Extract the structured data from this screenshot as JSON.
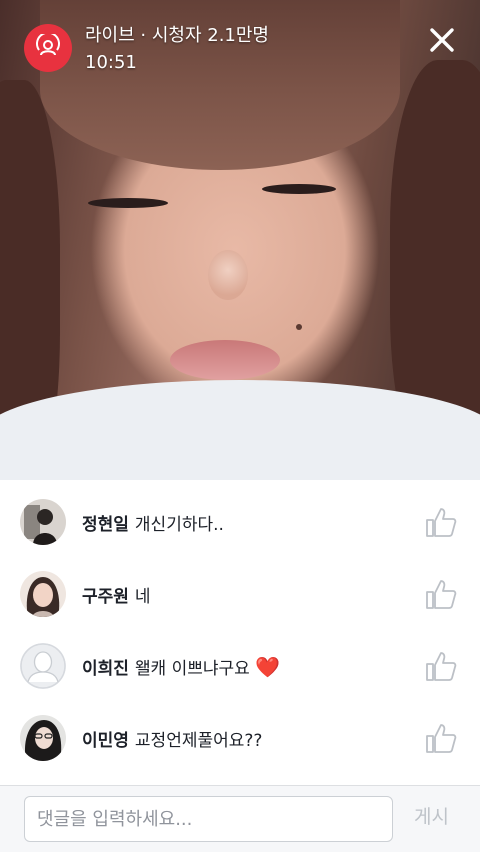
{
  "header": {
    "status_line": "라이브 · 시청자 2.1만명",
    "time": "10:51"
  },
  "icons": {
    "live": "live-broadcast-icon",
    "close": "close-icon",
    "like": "thumbs-up-icon",
    "default_avatar": "default-avatar-icon"
  },
  "colors": {
    "live_badge": "#e8323f",
    "heart": "#e0242f",
    "post_disabled": "#bec3c9"
  },
  "comments": [
    {
      "author": "정현일",
      "text": "개신기하다.."
    },
    {
      "author": "구주원",
      "text": "네"
    },
    {
      "author": "이희진",
      "text": "왤캐 이쁘냐구요",
      "emoji": "❤️"
    },
    {
      "author": "이민영",
      "text": "교정언제풀어요??"
    }
  ],
  "input": {
    "placeholder": "댓글을 입력하세요...",
    "value": ""
  },
  "post_button": {
    "label": "게시"
  }
}
